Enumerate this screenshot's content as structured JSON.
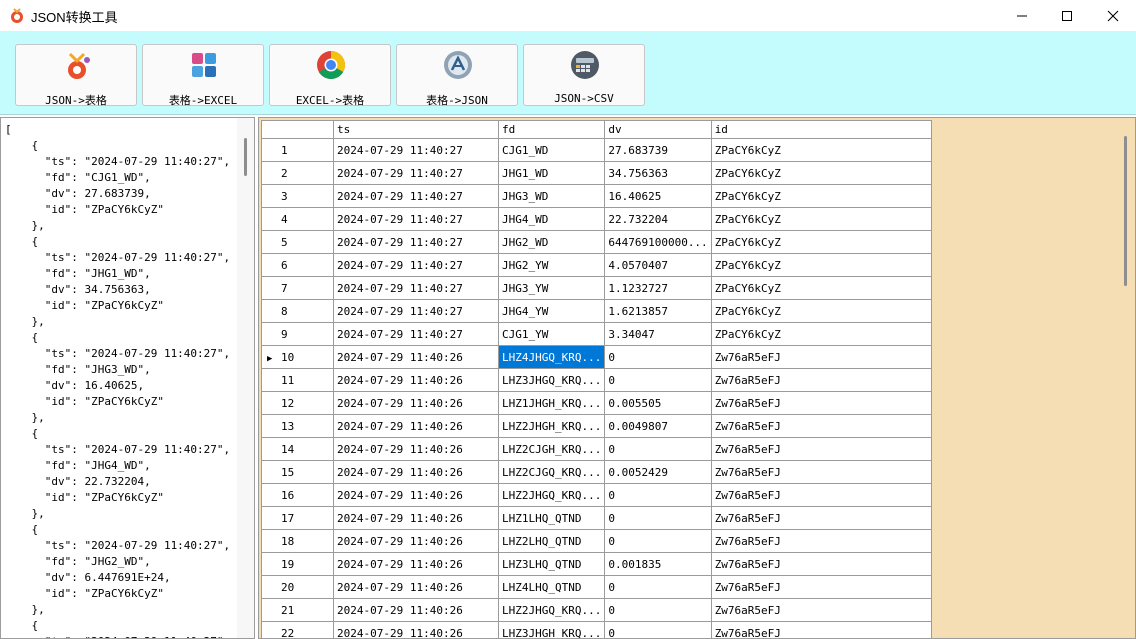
{
  "window": {
    "title": "JSON转换工具",
    "icon": "app-icon",
    "controls": [
      "minimize-icon",
      "maximize-icon",
      "close-icon"
    ]
  },
  "toolbar": {
    "background": "#c4fcfe",
    "buttons": [
      {
        "label": "JSON->表格",
        "icon": "json-to-table-icon"
      },
      {
        "label": "表格->EXCEL",
        "icon": "table-to-excel-icon"
      },
      {
        "label": "EXCEL->表格",
        "icon": "excel-to-table-icon"
      },
      {
        "label": "表格->JSON",
        "icon": "table-to-json-icon"
      },
      {
        "label": "JSON->CSV",
        "icon": "json-to-csv-icon"
      }
    ]
  },
  "json_text": "[\n    {\n      \"ts\": \"2024-07-29 11:40:27\",\n      \"fd\": \"CJG1_WD\",\n      \"dv\": 27.683739,\n      \"id\": \"ZPaCY6kCyZ\"\n    },\n    {\n      \"ts\": \"2024-07-29 11:40:27\",\n      \"fd\": \"JHG1_WD\",\n      \"dv\": 34.756363,\n      \"id\": \"ZPaCY6kCyZ\"\n    },\n    {\n      \"ts\": \"2024-07-29 11:40:27\",\n      \"fd\": \"JHG3_WD\",\n      \"dv\": 16.40625,\n      \"id\": \"ZPaCY6kCyZ\"\n    },\n    {\n      \"ts\": \"2024-07-29 11:40:27\",\n      \"fd\": \"JHG4_WD\",\n      \"dv\": 22.732204,\n      \"id\": \"ZPaCY6kCyZ\"\n    },\n    {\n      \"ts\": \"2024-07-29 11:40:27\",\n      \"fd\": \"JHG2_WD\",\n      \"dv\": 6.447691E+24,\n      \"id\": \"ZPaCY6kCyZ\"\n    },\n    {\n      \"ts\": \"2024-07-29 11:40:27\",",
  "grid": {
    "background": "#f5deb3",
    "selection_color": "#0078d7",
    "columns": [
      "",
      "ts",
      "fd",
      "dv",
      "id"
    ],
    "current_row": 10,
    "selected_cell": {
      "row": 10,
      "column": "fd"
    },
    "rows": [
      {
        "n": "1",
        "ts": "2024-07-29 11:40:27",
        "fd": "CJG1_WD",
        "dv": "27.683739",
        "id": "ZPaCY6kCyZ"
      },
      {
        "n": "2",
        "ts": "2024-07-29 11:40:27",
        "fd": "JHG1_WD",
        "dv": "34.756363",
        "id": "ZPaCY6kCyZ"
      },
      {
        "n": "3",
        "ts": "2024-07-29 11:40:27",
        "fd": "JHG3_WD",
        "dv": "16.40625",
        "id": "ZPaCY6kCyZ"
      },
      {
        "n": "4",
        "ts": "2024-07-29 11:40:27",
        "fd": "JHG4_WD",
        "dv": "22.732204",
        "id": "ZPaCY6kCyZ"
      },
      {
        "n": "5",
        "ts": "2024-07-29 11:40:27",
        "fd": "JHG2_WD",
        "dv": "644769100000...",
        "id": "ZPaCY6kCyZ"
      },
      {
        "n": "6",
        "ts": "2024-07-29 11:40:27",
        "fd": "JHG2_YW",
        "dv": "4.0570407",
        "id": "ZPaCY6kCyZ"
      },
      {
        "n": "7",
        "ts": "2024-07-29 11:40:27",
        "fd": "JHG3_YW",
        "dv": "1.1232727",
        "id": "ZPaCY6kCyZ"
      },
      {
        "n": "8",
        "ts": "2024-07-29 11:40:27",
        "fd": "JHG4_YW",
        "dv": "1.6213857",
        "id": "ZPaCY6kCyZ"
      },
      {
        "n": "9",
        "ts": "2024-07-29 11:40:27",
        "fd": "CJG1_YW",
        "dv": "3.34047",
        "id": "ZPaCY6kCyZ"
      },
      {
        "n": "10",
        "ts": "2024-07-29 11:40:26",
        "fd": "LHZ4JHGQ_KRQ...",
        "dv": "0",
        "id": "Zw76aR5eFJ"
      },
      {
        "n": "11",
        "ts": "2024-07-29 11:40:26",
        "fd": "LHZ3JHGQ_KRQ...",
        "dv": "0",
        "id": "Zw76aR5eFJ"
      },
      {
        "n": "12",
        "ts": "2024-07-29 11:40:26",
        "fd": "LHZ1JHGH_KRQ...",
        "dv": "0.005505",
        "id": "Zw76aR5eFJ"
      },
      {
        "n": "13",
        "ts": "2024-07-29 11:40:26",
        "fd": "LHZ2JHGH_KRQ...",
        "dv": "0.0049807",
        "id": "Zw76aR5eFJ"
      },
      {
        "n": "14",
        "ts": "2024-07-29 11:40:26",
        "fd": "LHZ2CJGH_KRQ...",
        "dv": "0",
        "id": "Zw76aR5eFJ"
      },
      {
        "n": "15",
        "ts": "2024-07-29 11:40:26",
        "fd": "LHZ2CJGQ_KRQ...",
        "dv": "0.0052429",
        "id": "Zw76aR5eFJ"
      },
      {
        "n": "16",
        "ts": "2024-07-29 11:40:26",
        "fd": "LHZ2JHGQ_KRQ...",
        "dv": "0",
        "id": "Zw76aR5eFJ"
      },
      {
        "n": "17",
        "ts": "2024-07-29 11:40:26",
        "fd": "LHZ1LHQ_QTND",
        "dv": "0",
        "id": "Zw76aR5eFJ"
      },
      {
        "n": "18",
        "ts": "2024-07-29 11:40:26",
        "fd": "LHZ2LHQ_QTND",
        "dv": "0",
        "id": "Zw76aR5eFJ"
      },
      {
        "n": "19",
        "ts": "2024-07-29 11:40:26",
        "fd": "LHZ3LHQ_QTND",
        "dv": "0.001835",
        "id": "Zw76aR5eFJ"
      },
      {
        "n": "20",
        "ts": "2024-07-29 11:40:26",
        "fd": "LHZ4LHQ_QTND",
        "dv": "0",
        "id": "Zw76aR5eFJ"
      },
      {
        "n": "21",
        "ts": "2024-07-29 11:40:26",
        "fd": "LHZ2JHGQ_KRQ...",
        "dv": "0",
        "id": "Zw76aR5eFJ"
      },
      {
        "n": "22",
        "ts": "2024-07-29 11:40:26",
        "fd": "LHZ3JHGH_KRQ...",
        "dv": "0",
        "id": "Zw76aR5eFJ"
      }
    ]
  }
}
